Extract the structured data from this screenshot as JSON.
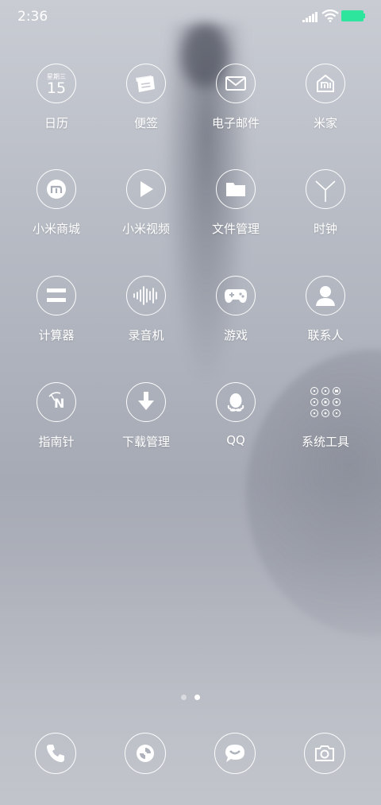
{
  "status_bar": {
    "time": "2:36",
    "battery_color": "#2ee59d"
  },
  "apps": [
    {
      "label": "日历",
      "icon": "calendar-icon",
      "weekday": "星期三",
      "day": "15"
    },
    {
      "label": "便签",
      "icon": "notes-icon"
    },
    {
      "label": "电子邮件",
      "icon": "mail-icon"
    },
    {
      "label": "米家",
      "icon": "mijia-icon"
    },
    {
      "label": "小米商城",
      "icon": "mi-store-icon"
    },
    {
      "label": "小米视频",
      "icon": "video-play-icon"
    },
    {
      "label": "文件管理",
      "icon": "folder-icon"
    },
    {
      "label": "时钟",
      "icon": "clock-icon"
    },
    {
      "label": "计算器",
      "icon": "calculator-icon"
    },
    {
      "label": "录音机",
      "icon": "recorder-icon"
    },
    {
      "label": "游戏",
      "icon": "gamepad-icon"
    },
    {
      "label": "联系人",
      "icon": "contacts-icon"
    },
    {
      "label": "指南针",
      "icon": "compass-icon",
      "letter": "N"
    },
    {
      "label": "下载管理",
      "icon": "download-icon"
    },
    {
      "label": "QQ",
      "icon": "qq-icon"
    },
    {
      "label": "系统工具",
      "icon": "folder-grid-icon"
    }
  ],
  "page_indicator": {
    "pages": 2,
    "current": 2
  },
  "dock": [
    {
      "icon": "phone-icon"
    },
    {
      "icon": "browser-icon"
    },
    {
      "icon": "messages-icon"
    },
    {
      "icon": "camera-icon"
    }
  ]
}
